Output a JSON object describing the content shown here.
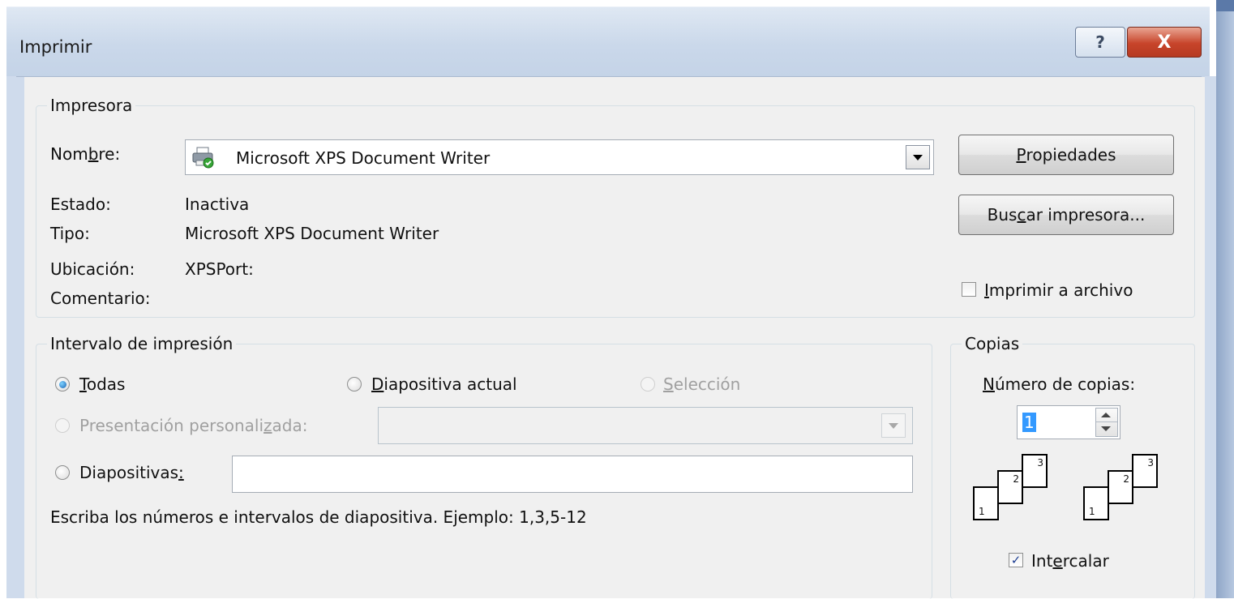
{
  "window": {
    "title": "Imprimir",
    "help_icon": "?",
    "close_icon": "X"
  },
  "printer": {
    "legend": "Impresora",
    "name_label_pre": "Nom",
    "name_label_accel": "b",
    "name_label_post": "re:",
    "selected_printer": "Microsoft XPS Document Writer",
    "status_label": "Estado:",
    "status_value": "Inactiva",
    "type_label": "Tipo:",
    "type_value": "Microsoft XPS Document Writer",
    "location_label": "Ubicación:",
    "location_value": "XPSPort:",
    "comment_label": "Comentario:",
    "properties_accel": "P",
    "properties_rest": "ropiedades",
    "find_pre": "Bus",
    "find_accel": "c",
    "find_post": "ar impresora...",
    "print_to_file_accel": "I",
    "print_to_file_rest": "mprimir a archivo",
    "print_to_file_checked": false
  },
  "range": {
    "legend": "Intervalo de impresión",
    "all_accel": "T",
    "all_rest": "odas",
    "current_accel": "D",
    "current_rest": "iapositiva actual",
    "selection_accel": "S",
    "selection_rest": "elección",
    "custom_pre": "Presentación personali",
    "custom_accel": "z",
    "custom_post": "ada:",
    "slides_pre": "Diapositivas",
    "slides_accel": ":",
    "slides_value": "",
    "hint": "Escriba los números e intervalos de diapositiva. Ejemplo: 1,3,5-12",
    "selected_option": "Todas"
  },
  "copies": {
    "legend": "Copias",
    "count_accel": "N",
    "count_rest": "úmero de copias:",
    "count_value": "1",
    "collate_pre": "Int",
    "collate_accel": "e",
    "collate_post": "rcalar",
    "collate_checked": true,
    "collate_check_glyph": "✓",
    "page_numbers": [
      "1",
      "2",
      "3"
    ]
  },
  "colors": {
    "titlebar": "#cad8ea",
    "client": "#f0f0f0",
    "close_button": "#c7442a",
    "selection_highlight": "#3399ff"
  }
}
